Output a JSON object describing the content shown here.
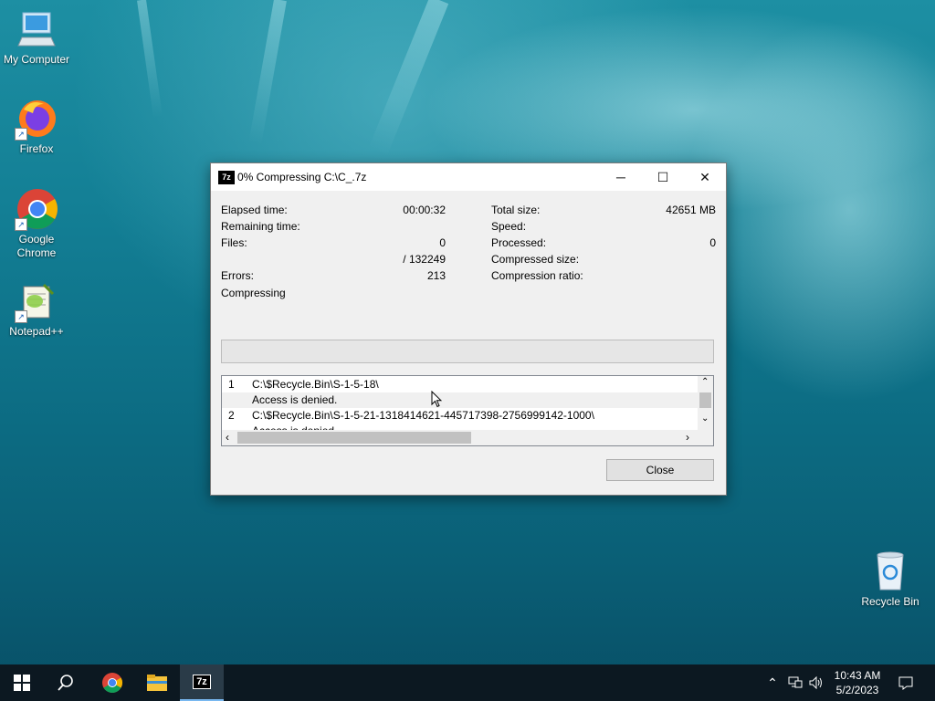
{
  "desktop": {
    "icons": [
      {
        "label": "My Computer",
        "icon": "computer-icon"
      },
      {
        "label": "Firefox",
        "icon": "firefox-icon"
      },
      {
        "label": "Google Chrome",
        "icon": "chrome-icon"
      },
      {
        "label": "Notepad++",
        "icon": "notepadpp-icon"
      },
      {
        "label": "Recycle Bin",
        "icon": "recycle-bin-icon"
      }
    ]
  },
  "dialog": {
    "app_icon_text": "7z",
    "title": "0% Compressing C:\\C_.7z",
    "controls": {
      "minimize": "─",
      "maximize": "☐",
      "close": "✕"
    },
    "stats_left": [
      {
        "label": "Elapsed time:",
        "value": "00:00:32"
      },
      {
        "label": "Remaining time:",
        "value": ""
      },
      {
        "label": "Files:",
        "value": "0"
      },
      {
        "label": "",
        "value": "/ 132249"
      },
      {
        "label": "Errors:",
        "value": "213"
      }
    ],
    "stats_right": [
      {
        "label": "Total size:",
        "value": "42651 MB"
      },
      {
        "label": "Speed:",
        "value": ""
      },
      {
        "label": "Processed:",
        "value": "0"
      },
      {
        "label": "Compressed size:",
        "value": ""
      },
      {
        "label": "Compression ratio:",
        "value": ""
      }
    ],
    "status": "Compressing",
    "progress": 0,
    "log": [
      {
        "num": "1",
        "text": "C:\\$Recycle.Bin\\S-1-5-18\\"
      },
      {
        "num": "",
        "text": "Access is denied."
      },
      {
        "num": "2",
        "text": "C:\\$Recycle.Bin\\S-1-5-21-1318414621-445717398-2756999142-1000\\"
      },
      {
        "num": "",
        "text": "Access is denied."
      }
    ],
    "close_button": "Close"
  },
  "taskbar": {
    "items": [
      "start-icon",
      "search-icon",
      "chrome-icon",
      "file-explorer-icon",
      "7zip-icon"
    ],
    "time": "10:43 AM",
    "date": "5/2/2023"
  }
}
